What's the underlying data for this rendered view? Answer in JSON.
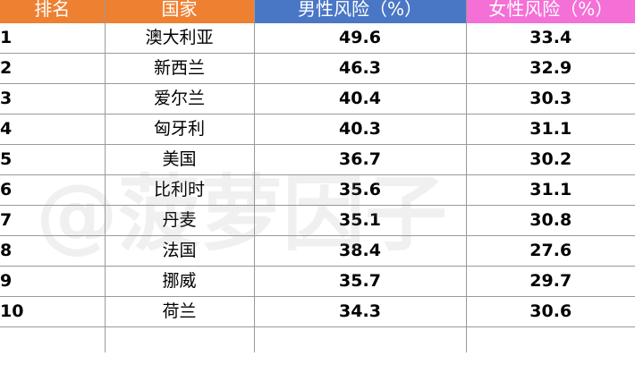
{
  "header": {
    "rank": "排名",
    "country": "国家",
    "male_risk": "男性风险（%）",
    "female_risk": "女性风险（%）"
  },
  "colors": {
    "rank_header_bg": "#EE8031",
    "country_header_bg": "#EE8031",
    "male_header_bg": "#4A76C6",
    "female_header_bg": "#F46FD6"
  },
  "rows": [
    {
      "rank": "1",
      "country": "澳大利亚",
      "male": "49.6",
      "female": "33.4"
    },
    {
      "rank": "2",
      "country": "新西兰",
      "male": "46.3",
      "female": "32.9"
    },
    {
      "rank": "3",
      "country": "爱尔兰",
      "male": "40.4",
      "female": "30.3"
    },
    {
      "rank": "4",
      "country": "匈牙利",
      "male": "40.3",
      "female": "31.1"
    },
    {
      "rank": "5",
      "country": "美国",
      "male": "36.7",
      "female": "30.2"
    },
    {
      "rank": "6",
      "country": "比利时",
      "male": "35.6",
      "female": "31.1"
    },
    {
      "rank": "7",
      "country": "丹麦",
      "male": "35.1",
      "female": "30.8"
    },
    {
      "rank": "8",
      "country": "法国",
      "male": "38.4",
      "female": "27.6"
    },
    {
      "rank": "9",
      "country": "挪威",
      "male": "35.7",
      "female": "29.7"
    },
    {
      "rank": "10",
      "country": "荷兰",
      "male": "34.3",
      "female": "30.6"
    }
  ],
  "watermark": "@菠萝因子"
}
